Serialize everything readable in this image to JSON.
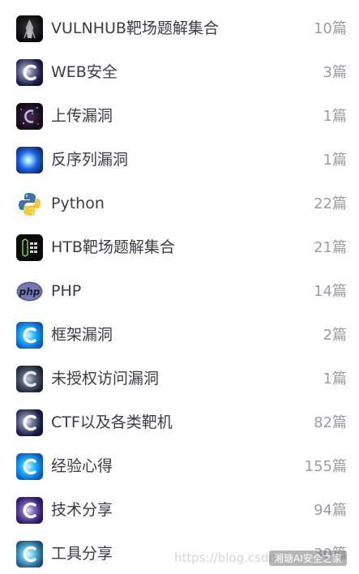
{
  "items": [
    {
      "label": "VULNHUB靶场题解集合",
      "count": "10篇",
      "icon": "dark-figure-icon"
    },
    {
      "label": "WEB安全",
      "count": "3篇",
      "icon": "c-logo-icon"
    },
    {
      "label": "上传漏洞",
      "count": "1篇",
      "icon": "noise-art-icon"
    },
    {
      "label": "反序列漏洞",
      "count": "1篇",
      "icon": "blue-glow-icon"
    },
    {
      "label": "Python",
      "count": "22篇",
      "icon": "python-logo-icon"
    },
    {
      "label": "HTB靶场题解集合",
      "count": "21篇",
      "icon": "htb-logo-icon"
    },
    {
      "label": "PHP",
      "count": "14篇",
      "icon": "php-logo-icon"
    },
    {
      "label": "框架漏洞",
      "count": "2篇",
      "icon": "c-logo-icon"
    },
    {
      "label": "未授权访问漏洞",
      "count": "1篇",
      "icon": "c-logo-icon"
    },
    {
      "label": "CTF以及各类靶机",
      "count": "82篇",
      "icon": "c-logo-icon"
    },
    {
      "label": "经验心得",
      "count": "155篇",
      "icon": "c-logo-icon"
    },
    {
      "label": "技术分享",
      "count": "94篇",
      "icon": "c-logo-icon"
    },
    {
      "label": "工具分享",
      "count": "30篇",
      "icon": "c-logo-icon"
    }
  ],
  "watermark": {
    "url": "https://blog.csdn.",
    "badge": "湘瑭AI安全之家"
  }
}
